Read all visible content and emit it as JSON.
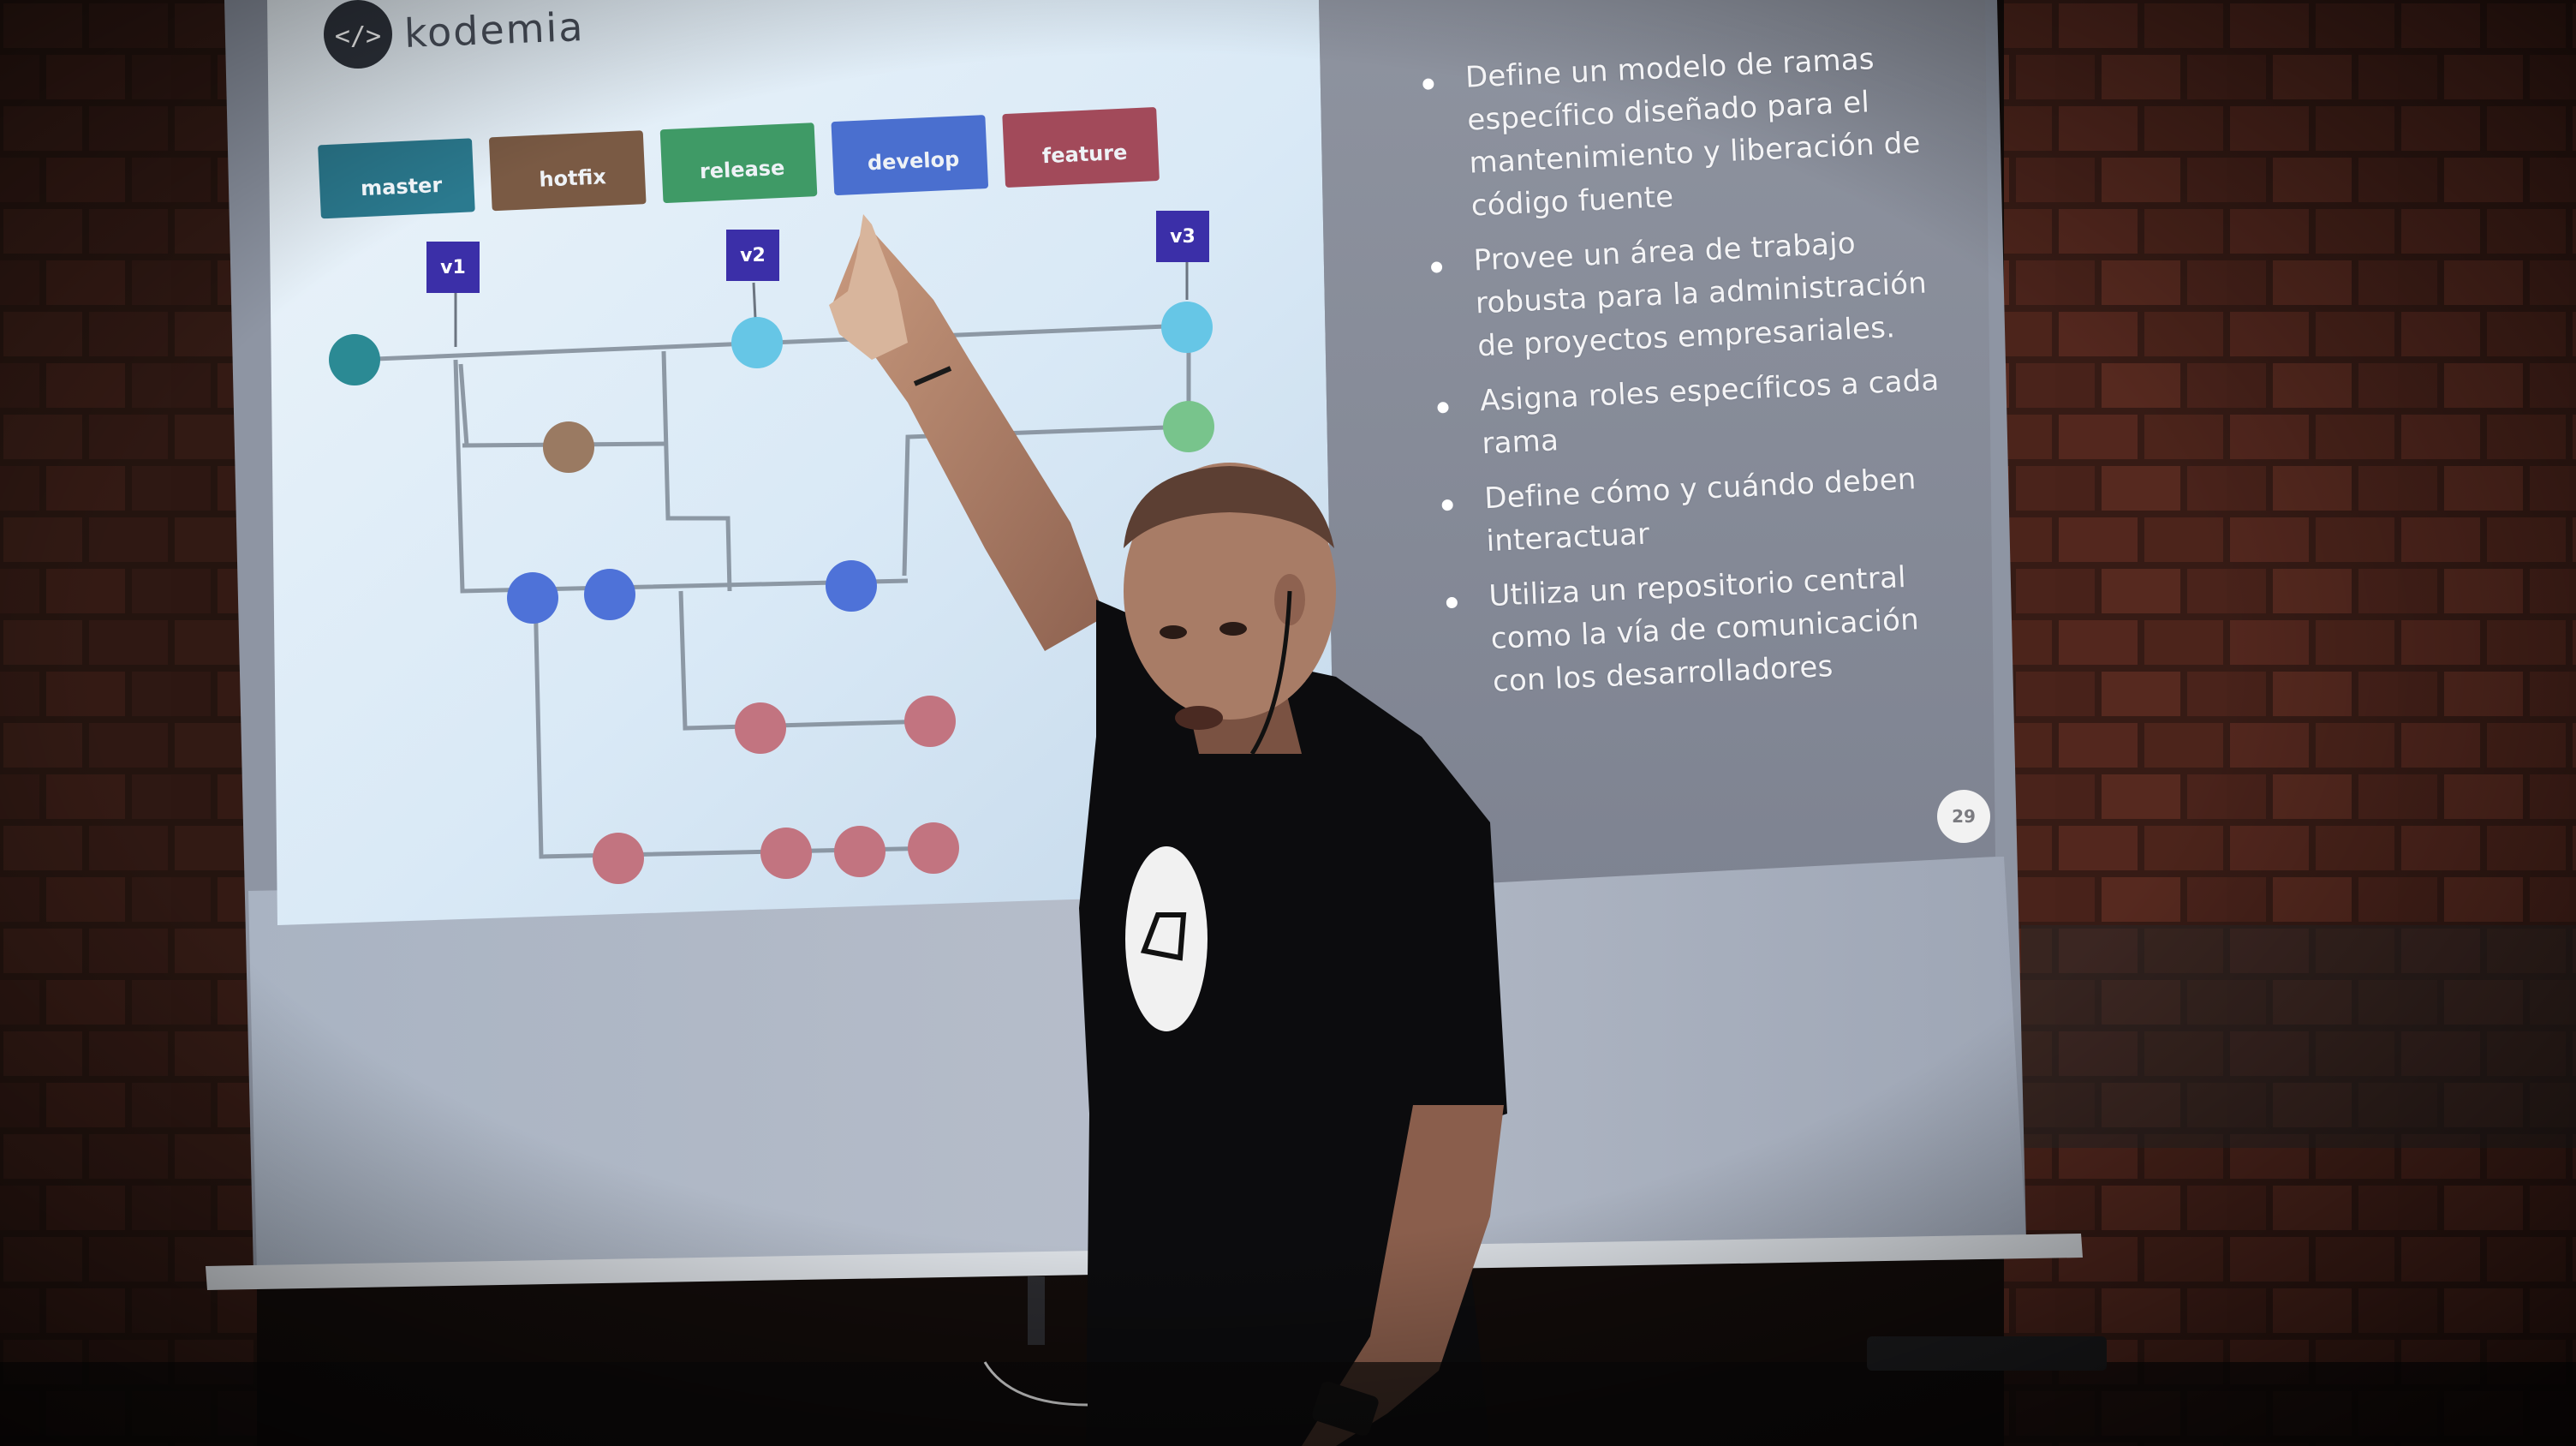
{
  "slide": {
    "logo_text": "kodemia",
    "branches": [
      "master",
      "hotfix",
      "release",
      "develop",
      "feature"
    ],
    "version_tags": [
      "v1",
      "v2",
      "v3"
    ],
    "bullets": [
      [
        "Define un modelo de ramas",
        "específico diseñado para el",
        "mantenimiento y  liberación de",
        "código fuente"
      ],
      [
        "Provee un área de trabajo",
        "robusta para la administración",
        "de proyectos empresariales."
      ],
      [
        "Asigna roles específicos a cada",
        "rama"
      ],
      [
        "Define cómo y cuándo deben",
        "interactuar"
      ],
      [
        "Utiliza un repositorio central",
        "como la vía de comunicación",
        "con los desarrolladores"
      ]
    ],
    "page_number": "29"
  },
  "colors": {
    "master": "#2b7a8f",
    "hotfix": "#7a5a44",
    "release": "#3f9a66",
    "develop": "#4a6fcf",
    "feature": "#a24a5a",
    "tag": "#3b2fa8",
    "commit_master": "#2b8a94",
    "commit_v": "#66c6e6",
    "commit_hotfix": "#9a7a62",
    "commit_release": "#78c48c",
    "commit_develop": "#4e72d8",
    "commit_feature": "#c27480"
  }
}
